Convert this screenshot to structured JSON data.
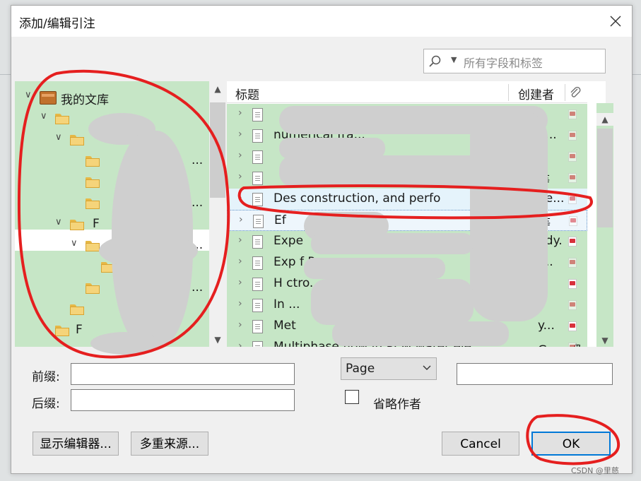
{
  "dialog": {
    "title": "添加/编辑引注"
  },
  "search": {
    "placeholder": "所有字段和标签"
  },
  "library": {
    "root_label": "我的文库",
    "visible_label_fragments": {
      "r7": "F",
      "r12": "F"
    },
    "trailing_fragments": {
      "r3": "...",
      "r5": "...",
      "r8": "...",
      "r10": "..."
    }
  },
  "items": {
    "columns": {
      "title": "标题",
      "creator": "创建者"
    },
    "rows": [
      {
        "title": "",
        "creator": ""
      },
      {
        "title": "numerical fra...",
        "creator": "a..."
      },
      {
        "title": "",
        "creator": ""
      },
      {
        "title": "",
        "creator": "等"
      },
      {
        "title": "Des  construction, and perfo",
        "creator": "pe..."
      },
      {
        "title": "Ef",
        "creator": "等"
      },
      {
        "title": "Expe",
        "creator": "udy."
      },
      {
        "title": "Exp                  f P...",
        "creator": "r..."
      },
      {
        "title": "H                   ctro...",
        "creator": ""
      },
      {
        "title": "In                    ...",
        "creator": ""
      },
      {
        "title": "Met",
        "creator": "y..."
      },
      {
        "title": "Multiphase flow in PEM water ele...",
        "creator": "Guan 等"
      }
    ]
  },
  "form": {
    "prefix_label": "前缀:",
    "suffix_label": "后缀:",
    "locator_value": "Page",
    "omit_author_label": "省略作者"
  },
  "buttons": {
    "show_editor": "显示编辑器...",
    "multiple_sources": "多重来源...",
    "cancel": "Cancel",
    "ok": "OK"
  },
  "watermark": "CSDN @里慈"
}
